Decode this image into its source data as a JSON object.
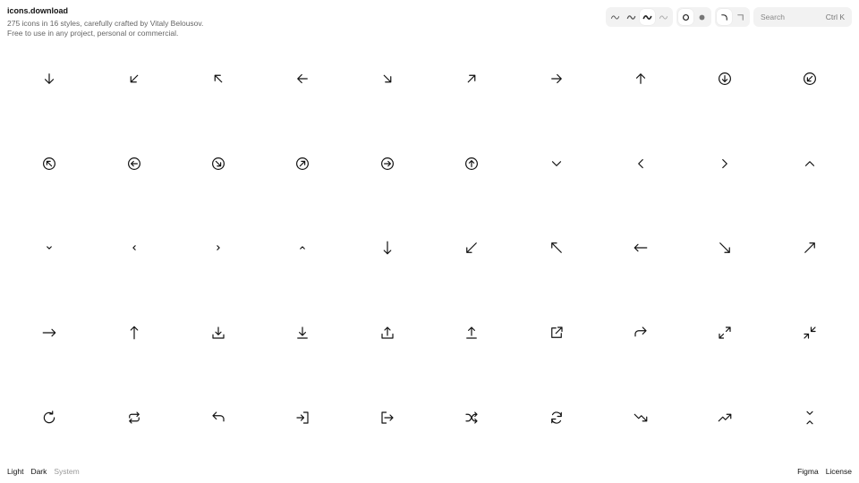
{
  "header": {
    "title": "icons.download",
    "tagline_line1": "275 icons in 16 styles, carefully crafted by Vitaly Belousov.",
    "tagline_line2": "Free to use in any project, personal or commercial."
  },
  "toolbar": {
    "stroke_weights": [
      {
        "name": "stroke-weight-thin",
        "width": 1.0,
        "color": "#555555",
        "active": false
      },
      {
        "name": "stroke-weight-light",
        "width": 1.4,
        "color": "#555555",
        "active": false
      },
      {
        "name": "stroke-weight-regular",
        "width": 1.8,
        "color": "#222222",
        "active": true
      },
      {
        "name": "stroke-weight-faint",
        "width": 1.0,
        "color": "#aaaaaa",
        "active": false
      }
    ],
    "fill_styles": [
      {
        "name": "outline-style",
        "fill": false,
        "active": true
      },
      {
        "name": "solid-style",
        "fill": true,
        "active": false
      }
    ],
    "corner_styles": [
      {
        "name": "rounded-corner-style",
        "rounded": true,
        "active": true
      },
      {
        "name": "sharp-corner-style",
        "rounded": false,
        "active": false
      }
    ],
    "search": {
      "placeholder": "Search",
      "shortcut": "Ctrl K"
    }
  },
  "icons": [
    "arrow-down",
    "arrow-down-left",
    "arrow-up-left",
    "arrow-left",
    "arrow-down-right",
    "arrow-up-right",
    "arrow-right",
    "arrow-up",
    "arrow-down-circle",
    "arrow-down-left-circle",
    "arrow-up-left-circle",
    "arrow-left-circle",
    "arrow-down-right-circle",
    "arrow-up-right-circle",
    "arrow-right-circle",
    "arrow-up-circle",
    "chevron-down",
    "chevron-left",
    "chevron-right",
    "chevron-up",
    "chevron-down-small",
    "chevron-left-small",
    "chevron-right-small",
    "chevron-up-small",
    "arrow-down-long",
    "arrow-down-left-long",
    "arrow-up-left-long",
    "arrow-left-long",
    "arrow-down-right-long",
    "arrow-up-right-long",
    "arrow-right-long",
    "arrow-up-long",
    "download",
    "download-alt",
    "upload",
    "upload-alt",
    "external-link",
    "redirect",
    "expand",
    "collapse",
    "refresh",
    "repeat",
    "undo",
    "sign-in",
    "sign-out",
    "shuffle",
    "sync",
    "trending-down",
    "trending-up",
    "fold-vertical"
  ],
  "colors": {
    "icon": "#111111",
    "muted": "#999999",
    "surface": "#f2f2f2"
  },
  "footer": {
    "themes": [
      {
        "label": "Light",
        "active": true
      },
      {
        "label": "Dark",
        "active": true
      },
      {
        "label": "System",
        "active": false
      }
    ],
    "links": [
      "Figma",
      "License"
    ]
  }
}
